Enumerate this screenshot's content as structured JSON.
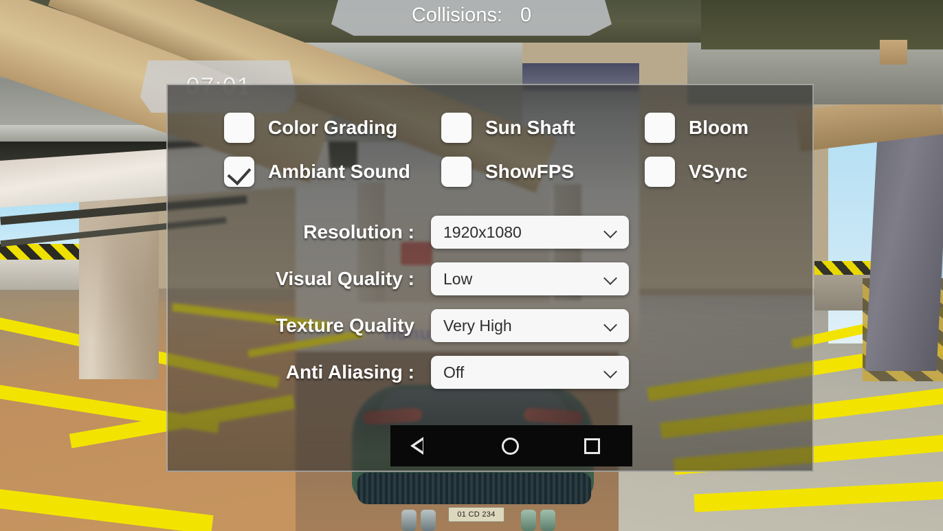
{
  "hud": {
    "collisions_label": "Collisions:",
    "collisions_value": "0",
    "timer": "07:01"
  },
  "scene": {
    "license_plate": "01 CD 234",
    "watermark": "nunu"
  },
  "settings": {
    "checkboxes": [
      {
        "id": "color-grading",
        "label": "Color Grading",
        "checked": false
      },
      {
        "id": "sun-shaft",
        "label": "Sun Shaft",
        "checked": false
      },
      {
        "id": "bloom",
        "label": "Bloom",
        "checked": false
      },
      {
        "id": "ambiant-sound",
        "label": "Ambiant Sound",
        "checked": true
      },
      {
        "id": "show-fps",
        "label": "ShowFPS",
        "checked": false
      },
      {
        "id": "vsync",
        "label": "VSync",
        "checked": false
      }
    ],
    "rows": [
      {
        "id": "resolution",
        "label": "Resolution :",
        "value": "1920x1080"
      },
      {
        "id": "visual-quality",
        "label": "Visual Quality :",
        "value": "Low"
      },
      {
        "id": "texture-quality",
        "label": "Texture Quality",
        "value": "Very High"
      },
      {
        "id": "anti-aliasing",
        "label": "Anti Aliasing :",
        "value": "Off"
      }
    ]
  },
  "navbar": {
    "back": "back-icon",
    "home": "home-icon",
    "recents": "recents-icon"
  },
  "colors": {
    "panel_fill": "#3a3a38",
    "panel_border": "#e1e1de",
    "checkbox_fill": "#fafafa",
    "select_fill": "#f7f7f7",
    "label_text": "#ffffff",
    "value_text": "#2e2e2e",
    "navbar_bg": "#090909",
    "parking_line": "#f2e400"
  }
}
